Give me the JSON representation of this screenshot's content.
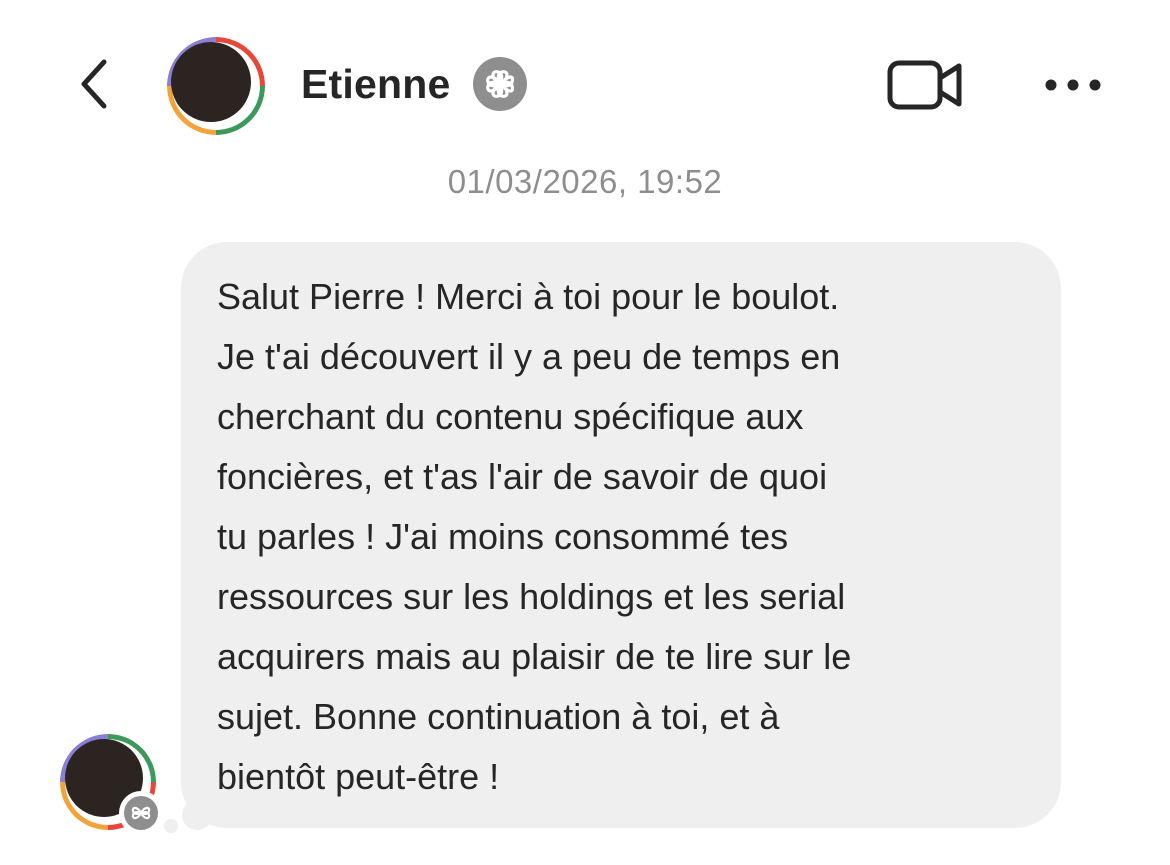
{
  "header": {
    "contact_name": "Etienne",
    "back_icon": "chevron-left-icon",
    "verified_badge_icon": "meta-verified-icon",
    "video_call_icon": "video-camera-icon",
    "more_icon": "more-horizontal-icon"
  },
  "conversation": {
    "timestamp": "01/03/2026, 19:52",
    "messages": [
      {
        "sender": "Etienne",
        "text": "Salut Pierre ! Merci à toi pour le boulot.\nJe t'ai découvert il y a peu de temps en\ncherchant du contenu spécifique aux\nfoncières, et t'as l'air de savoir de quoi\ntu parles ! J'ai moins consommé tes\nressources sur les holdings et les serial\nacquirers mais au plaisir de te lire sur le\nsujet. Bonne continuation à toi, et à\nbientôt peut-être !"
      }
    ]
  },
  "colors": {
    "text": "#262626",
    "timestamp": "#8e8e8e",
    "bubble": "#efefef",
    "badge": "#8e8e8e"
  }
}
